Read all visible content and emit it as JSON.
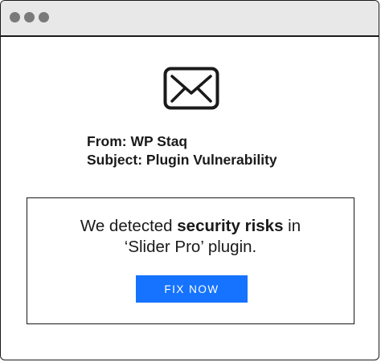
{
  "window": {
    "controls": [
      "close",
      "minimize",
      "maximize"
    ]
  },
  "email": {
    "icon": "envelope-icon",
    "from_label": "From:",
    "from_value": "WP Staq",
    "subject_label": "Subject:",
    "subject_value": "Plugin Vulnerability"
  },
  "message": {
    "text_before": "We detected ",
    "text_bold": "security risks",
    "text_after": " in",
    "line2": "‘Slider Pro’ plugin.",
    "button_label": "FIX NOW"
  },
  "colors": {
    "accent": "#1573ff",
    "titlebar": "#e8e8e8",
    "dots": "#7a7a7a",
    "text": "#1a1a1a"
  }
}
